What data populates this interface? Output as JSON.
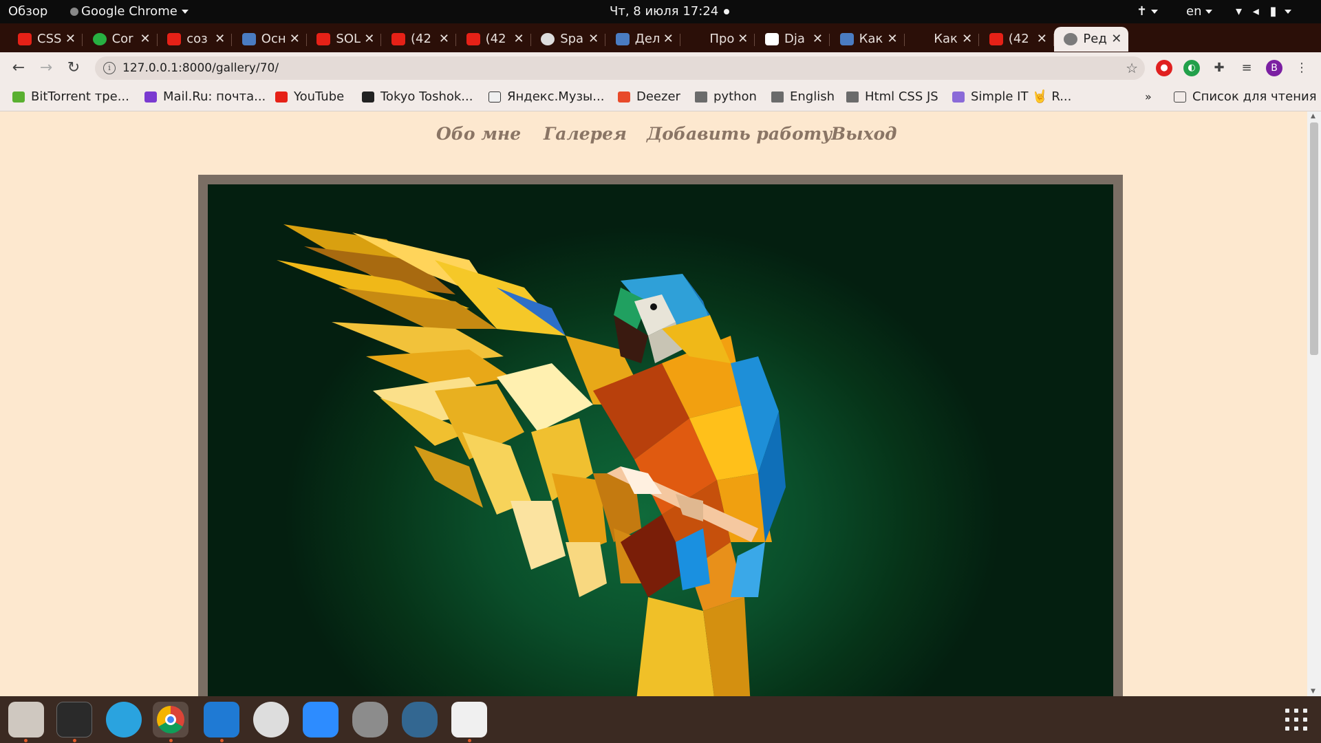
{
  "system": {
    "activities": "Обзор",
    "app_name": "Google Chrome",
    "datetime": "Чт, 8 июля  17:24",
    "language": "en"
  },
  "tabs": [
    {
      "title": "CSS",
      "icon": "youtube-icon"
    },
    {
      "title": "Cor",
      "icon": "plus-circle-icon"
    },
    {
      "title": "соз",
      "icon": "youtube-icon"
    },
    {
      "title": "Осн",
      "icon": "puzzle-blue-icon"
    },
    {
      "title": "SOL",
      "icon": "youtube-icon"
    },
    {
      "title": "(42",
      "icon": "youtube-icon"
    },
    {
      "title": "(42",
      "icon": "youtube-icon"
    },
    {
      "title": "Spa",
      "icon": "github-icon"
    },
    {
      "title": "Дел",
      "icon": "puzzle-blue-icon"
    },
    {
      "title": "Про",
      "icon": "bolt-icon"
    },
    {
      "title": "Dja",
      "icon": "django-icon"
    },
    {
      "title": "Как",
      "icon": "puzzle-blue-icon"
    },
    {
      "title": "Как",
      "icon": "bug-icon"
    },
    {
      "title": "(42",
      "icon": "youtube-icon"
    },
    {
      "title": "Ред",
      "icon": "globe-icon",
      "active": true
    }
  ],
  "toolbar": {
    "url": "127.0.0.1:8000/gallery/70/",
    "profile_initial": "B"
  },
  "bookmarks": [
    {
      "label": "BitTorrent тре...",
      "icon": "bittorrent-icon"
    },
    {
      "label": "Mail.Ru: почта...",
      "icon": "mailru-icon"
    },
    {
      "label": "YouTube",
      "icon": "youtube-icon"
    },
    {
      "label": "Tokyo Toshok...",
      "icon": "tokyo-icon"
    },
    {
      "label": "Яндекс.Музы...",
      "icon": "yandex-music-icon"
    },
    {
      "label": "Deezer",
      "icon": "deezer-icon"
    },
    {
      "label": "python",
      "icon": "folder-icon"
    },
    {
      "label": "English",
      "icon": "folder-icon"
    },
    {
      "label": "Html CSS JS",
      "icon": "folder-icon"
    },
    {
      "label": "Simple IT 🤘 R...",
      "icon": "simpleit-icon"
    }
  ],
  "bookmarks_more": "»",
  "reading_list": "Список для чтения",
  "site_nav": [
    "Обо мне",
    "Галерея",
    "Добавить работу",
    "Выход"
  ],
  "colors": {
    "page_bg": "#fde8cf",
    "nav_text": "#8a7565",
    "frame": "#7a6e64",
    "artwork_bg": "#0a4e2a",
    "tabstrip": "#2b0f08"
  }
}
